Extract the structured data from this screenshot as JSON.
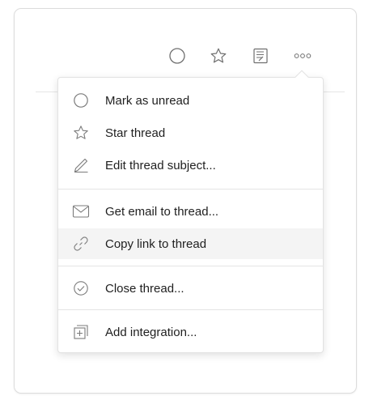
{
  "toolbar": {
    "icons": [
      "circle-icon",
      "star-icon",
      "notes-icon",
      "more-icon"
    ]
  },
  "menu": {
    "items": [
      {
        "label": "Mark as unread",
        "icon": "circle-icon"
      },
      {
        "label": "Star thread",
        "icon": "star-icon"
      },
      {
        "label": "Edit thread subject...",
        "icon": "pencil-icon"
      },
      {
        "label": "Get email to thread...",
        "icon": "envelope-icon"
      },
      {
        "label": "Copy link to thread",
        "icon": "link-icon",
        "highlighted": true
      },
      {
        "label": "Close thread...",
        "icon": "check-circle-icon"
      },
      {
        "label": "Add integration...",
        "icon": "add-integration-icon"
      }
    ]
  },
  "colors": {
    "icon_stroke": "#7b7b7b",
    "text": "#1f1f1f",
    "hover_bg": "#f4f4f4",
    "border": "#e2e2e2"
  }
}
